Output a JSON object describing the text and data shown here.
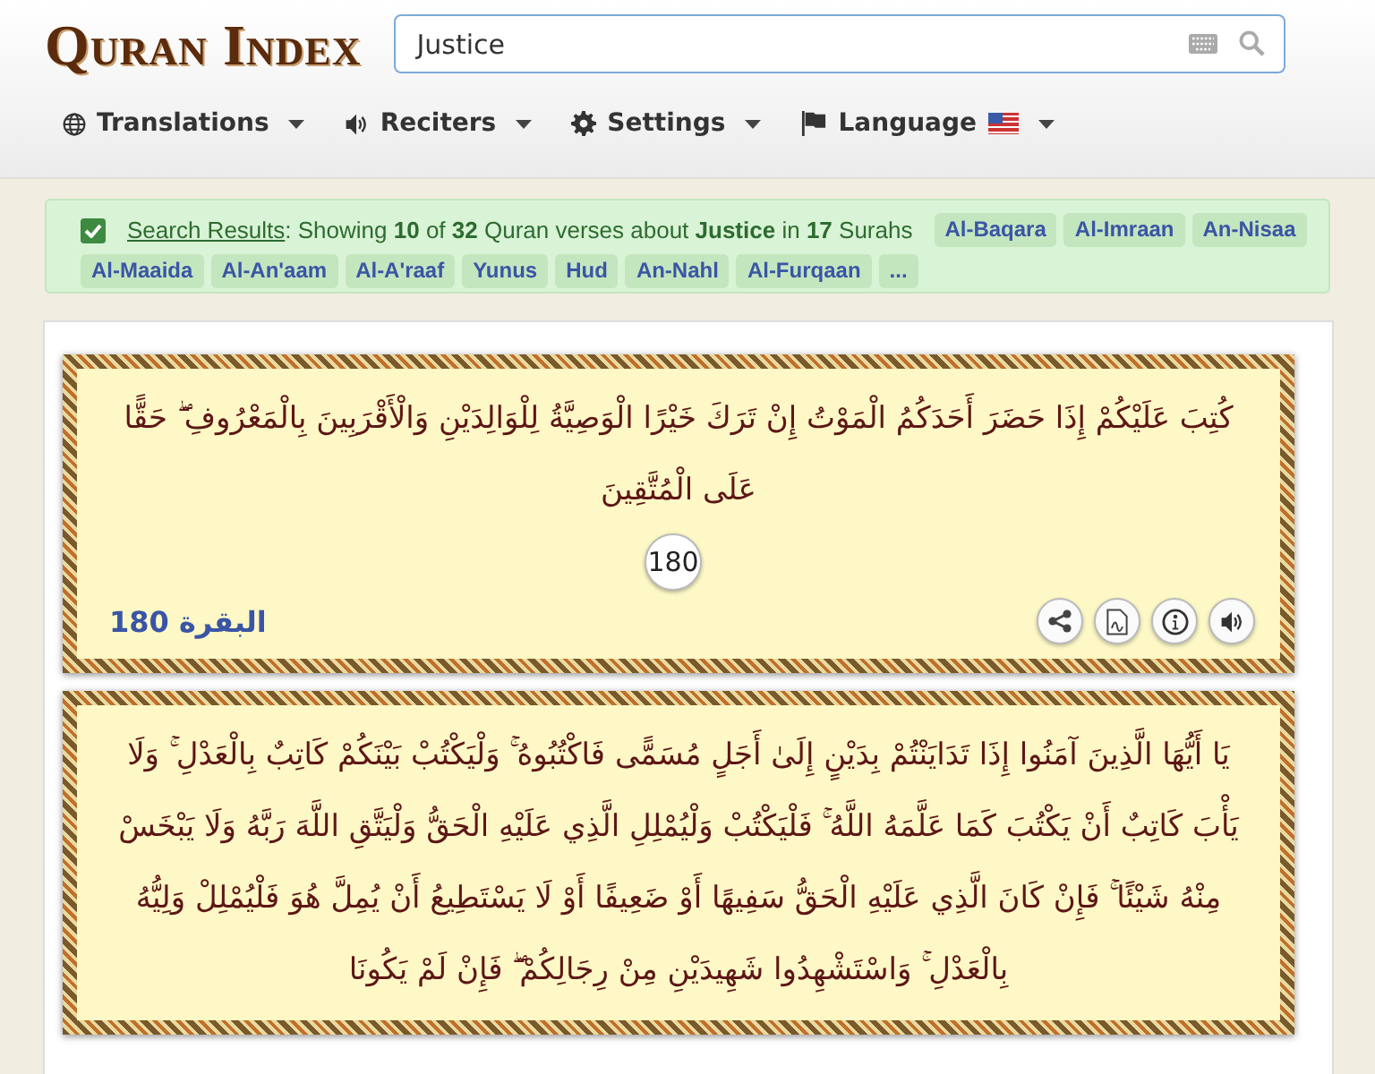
{
  "header": {
    "logo": "Quran Index",
    "search": {
      "value": "Justice"
    }
  },
  "nav": [
    {
      "label": "Translations"
    },
    {
      "label": "Reciters"
    },
    {
      "label": "Settings"
    },
    {
      "label": "Language"
    }
  ],
  "results": {
    "checked": true,
    "link": "Search Results",
    "summary": ": Showing **10** of **32** Quran verses about **Justice** in **17** Surahs",
    "surahs": [
      "Al-Baqara",
      "Al-Imraan",
      "An-Nisaa",
      "Al-Maaida",
      "Al-An'aam",
      "Al-A'raaf",
      "Yunus",
      "Hud",
      "An-Nahl",
      "Al-Furqaan",
      "..."
    ]
  },
  "verses": [
    {
      "text": "كُتِبَ عَلَيْكُمْ إِذَا حَضَرَ أَحَدَكُمُ الْمَوْتُ إِنْ تَرَكَ خَيْرًا الْوَصِيَّةُ لِلْوَالِدَيْنِ وَالْأَقْرَبِينَ بِالْمَعْرُوفِ ۖ حَقًّا عَلَى الْمُتَّقِينَ",
      "number": "180",
      "reference": "البقرة 180"
    },
    {
      "text": "يَا أَيُّهَا الَّذِينَ آمَنُوا إِذَا تَدَايَنْتُمْ بِدَيْنٍ إِلَىٰ أَجَلٍ مُسَمًّى فَاكْتُبُوهُ ۚ وَلْيَكْتُبْ بَيْنَكُمْ كَاتِبٌ بِالْعَدْلِ ۚ وَلَا يَأْبَ كَاتِبٌ أَنْ يَكْتُبَ كَمَا عَلَّمَهُ اللَّهُ ۚ فَلْيَكْتُبْ وَلْيُمْلِلِ الَّذِي عَلَيْهِ الْحَقُّ وَلْيَتَّقِ اللَّهَ رَبَّهُ وَلَا يَبْخَسْ مِنْهُ شَيْئًا ۚ فَإِنْ كَانَ الَّذِي عَلَيْهِ الْحَقُّ سَفِيهًا أَوْ ضَعِيفًا أَوْ لَا يَسْتَطِيعُ أَنْ يُمِلَّ هُوَ فَلْيُمْلِلْ وَلِيُّهُ بِالْعَدْلِ ۚ وَاسْتَشْهِدُوا شَهِيدَيْنِ مِنْ رِجَالِكُمْ ۖ فَإِنْ لَمْ يَكُونَا"
    }
  ]
}
